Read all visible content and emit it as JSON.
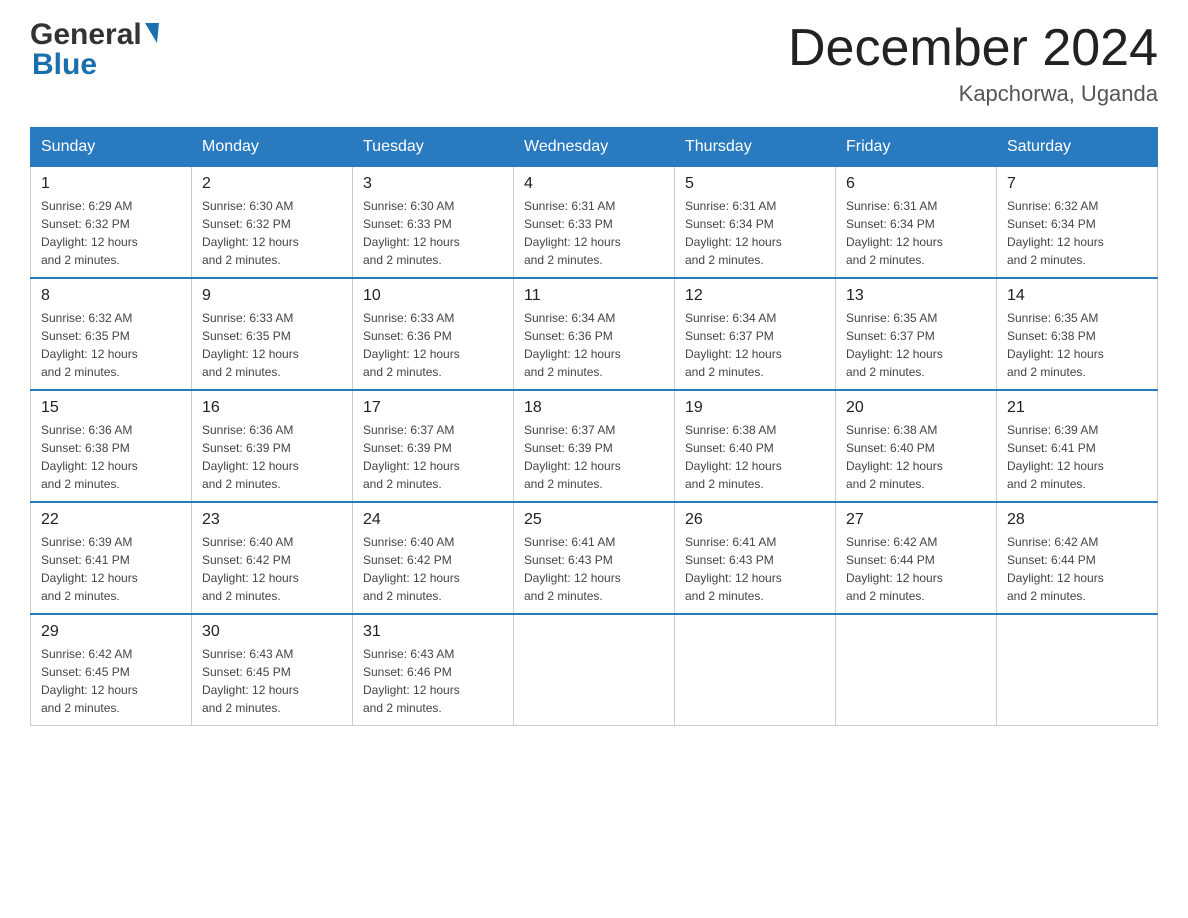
{
  "header": {
    "logo_general": "General",
    "logo_blue": "Blue",
    "month_title": "December 2024",
    "location": "Kapchorwa, Uganda"
  },
  "calendar": {
    "days_of_week": [
      "Sunday",
      "Monday",
      "Tuesday",
      "Wednesday",
      "Thursday",
      "Friday",
      "Saturday"
    ],
    "weeks": [
      [
        {
          "day": "1",
          "sunrise": "6:29 AM",
          "sunset": "6:32 PM",
          "daylight": "12 hours and 2 minutes."
        },
        {
          "day": "2",
          "sunrise": "6:30 AM",
          "sunset": "6:32 PM",
          "daylight": "12 hours and 2 minutes."
        },
        {
          "day": "3",
          "sunrise": "6:30 AM",
          "sunset": "6:33 PM",
          "daylight": "12 hours and 2 minutes."
        },
        {
          "day": "4",
          "sunrise": "6:31 AM",
          "sunset": "6:33 PM",
          "daylight": "12 hours and 2 minutes."
        },
        {
          "day": "5",
          "sunrise": "6:31 AM",
          "sunset": "6:34 PM",
          "daylight": "12 hours and 2 minutes."
        },
        {
          "day": "6",
          "sunrise": "6:31 AM",
          "sunset": "6:34 PM",
          "daylight": "12 hours and 2 minutes."
        },
        {
          "day": "7",
          "sunrise": "6:32 AM",
          "sunset": "6:34 PM",
          "daylight": "12 hours and 2 minutes."
        }
      ],
      [
        {
          "day": "8",
          "sunrise": "6:32 AM",
          "sunset": "6:35 PM",
          "daylight": "12 hours and 2 minutes."
        },
        {
          "day": "9",
          "sunrise": "6:33 AM",
          "sunset": "6:35 PM",
          "daylight": "12 hours and 2 minutes."
        },
        {
          "day": "10",
          "sunrise": "6:33 AM",
          "sunset": "6:36 PM",
          "daylight": "12 hours and 2 minutes."
        },
        {
          "day": "11",
          "sunrise": "6:34 AM",
          "sunset": "6:36 PM",
          "daylight": "12 hours and 2 minutes."
        },
        {
          "day": "12",
          "sunrise": "6:34 AM",
          "sunset": "6:37 PM",
          "daylight": "12 hours and 2 minutes."
        },
        {
          "day": "13",
          "sunrise": "6:35 AM",
          "sunset": "6:37 PM",
          "daylight": "12 hours and 2 minutes."
        },
        {
          "day": "14",
          "sunrise": "6:35 AM",
          "sunset": "6:38 PM",
          "daylight": "12 hours and 2 minutes."
        }
      ],
      [
        {
          "day": "15",
          "sunrise": "6:36 AM",
          "sunset": "6:38 PM",
          "daylight": "12 hours and 2 minutes."
        },
        {
          "day": "16",
          "sunrise": "6:36 AM",
          "sunset": "6:39 PM",
          "daylight": "12 hours and 2 minutes."
        },
        {
          "day": "17",
          "sunrise": "6:37 AM",
          "sunset": "6:39 PM",
          "daylight": "12 hours and 2 minutes."
        },
        {
          "day": "18",
          "sunrise": "6:37 AM",
          "sunset": "6:39 PM",
          "daylight": "12 hours and 2 minutes."
        },
        {
          "day": "19",
          "sunrise": "6:38 AM",
          "sunset": "6:40 PM",
          "daylight": "12 hours and 2 minutes."
        },
        {
          "day": "20",
          "sunrise": "6:38 AM",
          "sunset": "6:40 PM",
          "daylight": "12 hours and 2 minutes."
        },
        {
          "day": "21",
          "sunrise": "6:39 AM",
          "sunset": "6:41 PM",
          "daylight": "12 hours and 2 minutes."
        }
      ],
      [
        {
          "day": "22",
          "sunrise": "6:39 AM",
          "sunset": "6:41 PM",
          "daylight": "12 hours and 2 minutes."
        },
        {
          "day": "23",
          "sunrise": "6:40 AM",
          "sunset": "6:42 PM",
          "daylight": "12 hours and 2 minutes."
        },
        {
          "day": "24",
          "sunrise": "6:40 AM",
          "sunset": "6:42 PM",
          "daylight": "12 hours and 2 minutes."
        },
        {
          "day": "25",
          "sunrise": "6:41 AM",
          "sunset": "6:43 PM",
          "daylight": "12 hours and 2 minutes."
        },
        {
          "day": "26",
          "sunrise": "6:41 AM",
          "sunset": "6:43 PM",
          "daylight": "12 hours and 2 minutes."
        },
        {
          "day": "27",
          "sunrise": "6:42 AM",
          "sunset": "6:44 PM",
          "daylight": "12 hours and 2 minutes."
        },
        {
          "day": "28",
          "sunrise": "6:42 AM",
          "sunset": "6:44 PM",
          "daylight": "12 hours and 2 minutes."
        }
      ],
      [
        {
          "day": "29",
          "sunrise": "6:42 AM",
          "sunset": "6:45 PM",
          "daylight": "12 hours and 2 minutes."
        },
        {
          "day": "30",
          "sunrise": "6:43 AM",
          "sunset": "6:45 PM",
          "daylight": "12 hours and 2 minutes."
        },
        {
          "day": "31",
          "sunrise": "6:43 AM",
          "sunset": "6:46 PM",
          "daylight": "12 hours and 2 minutes."
        },
        null,
        null,
        null,
        null
      ]
    ]
  }
}
